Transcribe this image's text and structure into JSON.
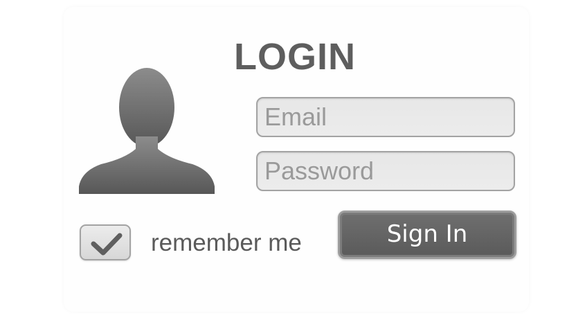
{
  "login": {
    "title": "LOGIN",
    "email_placeholder": "Email",
    "password_placeholder": "Password",
    "remember_label": "remember me",
    "remember_checked": true,
    "signin_label": "Sign In"
  },
  "icons": {
    "avatar": "user-silhouette-icon",
    "checkmark": "checkmark-icon"
  },
  "colors": {
    "title": "#5e5e5e",
    "button_bg": "#616161",
    "field_bg": "#e9e9e9",
    "border": "#a3a3a3"
  }
}
